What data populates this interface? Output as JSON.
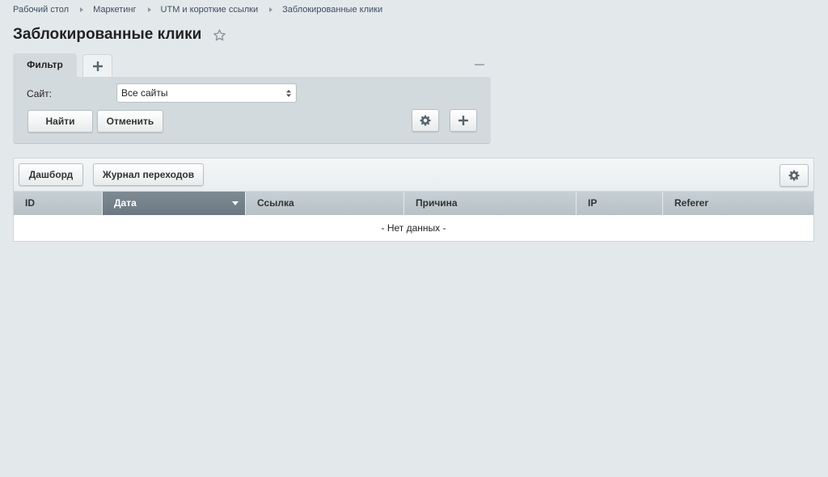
{
  "breadcrumb": [
    "Рабочий стол",
    "Маркетинг",
    "UTM и короткие ссылки",
    "Заблокированные клики"
  ],
  "page_title": "Заблокированные клики",
  "filter": {
    "tab_label": "Фильтр",
    "site_label": "Сайт:",
    "site_value": "Все сайты",
    "find_label": "Найти",
    "cancel_label": "Отменить"
  },
  "toolbar": {
    "dashboard_label": "Дашборд",
    "journal_label": "Журнал переходов"
  },
  "table": {
    "columns": [
      "ID",
      "Дата",
      "Ссылка",
      "Причина",
      "IP",
      "Referer"
    ],
    "sorted_column": "Дата",
    "empty_text": "- Нет данных -"
  },
  "icons": {
    "favorite": "star-icon",
    "add_tab": "plus-icon",
    "collapse": "minus-icon",
    "settings": "gear-icon",
    "add_field": "plus-icon",
    "sort": "sort-down-icon"
  },
  "colors": {
    "background": "#e3e9eb",
    "filter_panel": "#d3dadd",
    "header": "#bcc5ca",
    "sorted_header": "#74818a"
  }
}
